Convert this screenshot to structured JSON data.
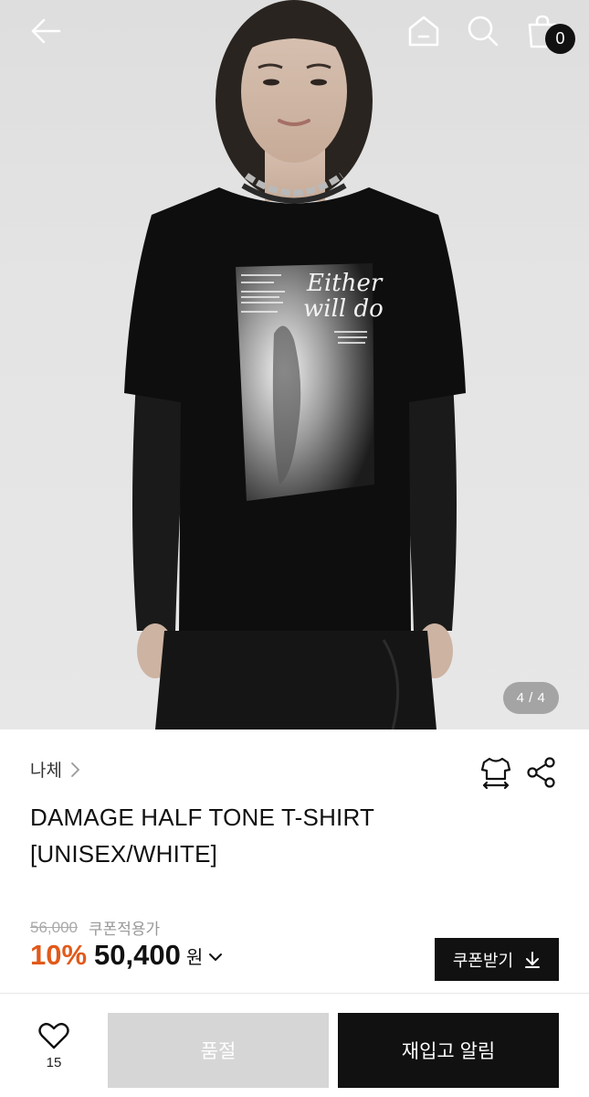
{
  "header": {
    "cart_count": "0"
  },
  "gallery": {
    "counter": "4 / 4",
    "print": {
      "headline_line1": "Either",
      "headline_line2": "will do"
    }
  },
  "product": {
    "brand": "나체",
    "title_line1": "DAMAGE HALF TONE T-SHIRT",
    "title_line2": "[UNISEX/WHITE]",
    "original_price": "56,000",
    "coupon_note": "쿠폰적용가",
    "discount": "10%",
    "price": "50,400",
    "currency": "원",
    "coupon_button_label": "쿠폰받기"
  },
  "bottom_bar": {
    "like_count": "15",
    "soldout_label": "품절",
    "restock_label": "재입고 알림"
  },
  "colors": {
    "accent_discount": "#e15a1a",
    "dark": "#111111",
    "disabled": "#d6d6d6"
  }
}
